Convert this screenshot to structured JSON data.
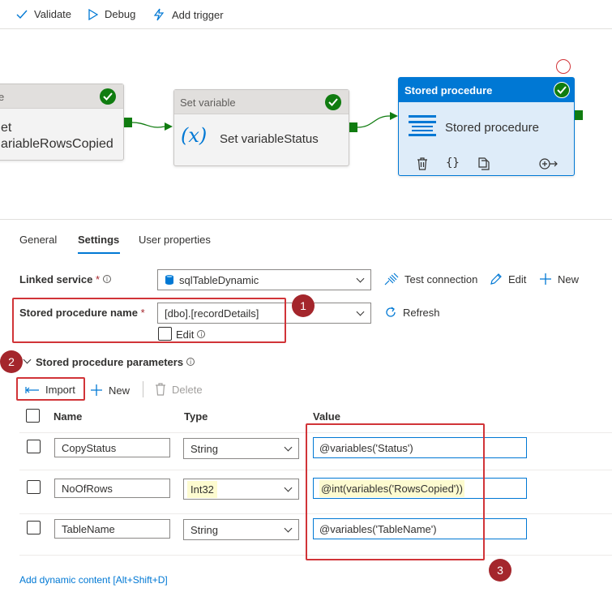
{
  "toolbar": {
    "validate": "Validate",
    "debug": "Debug",
    "add_trigger": "Add trigger"
  },
  "canvas": {
    "activity1": {
      "header": "e",
      "line1": "et",
      "line2": "ariableRowsCopied"
    },
    "activity2": {
      "header": "Set variable",
      "name": "Set variableStatus",
      "icon_text": "(x)"
    },
    "activity3": {
      "header": "Stored procedure",
      "name": "Stored procedure"
    }
  },
  "tabs": [
    {
      "label": "General"
    },
    {
      "label": "Settings"
    },
    {
      "label": "User properties"
    }
  ],
  "settings": {
    "linked_service_label": "Linked service",
    "linked_service_value": "sqlTableDynamic",
    "test_connection": "Test connection",
    "edit": "Edit",
    "new": "New",
    "sp_name_label": "Stored procedure name",
    "sp_name_value": "[dbo].[recordDetails]",
    "refresh": "Refresh",
    "edit_checkbox_label": "Edit",
    "params_label": "Stored procedure parameters",
    "import": "Import",
    "params_new": "New",
    "params_delete": "Delete",
    "columns": {
      "name": "Name",
      "type": "Type",
      "value": "Value"
    },
    "params": [
      {
        "name": "CopyStatus",
        "type": "String",
        "value": "@variables('Status')"
      },
      {
        "name": "NoOfRows",
        "type": "Int32",
        "value": "@int(variables('RowsCopied'))"
      },
      {
        "name": "TableName",
        "type": "String",
        "value": "@variables('TableName')"
      }
    ],
    "dynamic_content_link": "Add dynamic content [Alt+Shift+D]",
    "required_mark": "*",
    "info_mark": "i"
  },
  "annotations": {
    "badge1": "1",
    "badge2": "2",
    "badge3": "3"
  },
  "colors": {
    "accent": "#0078d4",
    "success": "#107c10",
    "annotation": "#d13438",
    "badge": "#a4262c"
  }
}
